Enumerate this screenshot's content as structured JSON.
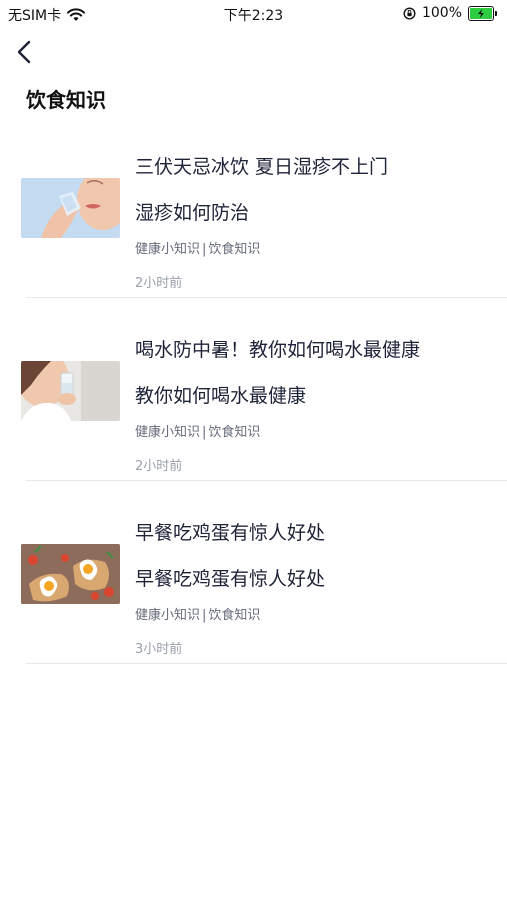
{
  "status_bar": {
    "carrier": "无SIM卡",
    "time": "下午2:23",
    "battery": "100%",
    "battery_color": "#2ecc40"
  },
  "header": {
    "back_icon": "chevron-left-icon",
    "title": "饮食知识"
  },
  "articles": [
    {
      "title": "三伏天忌冰饮 夏日湿疹不上门",
      "subtitle": "湿疹如何防治",
      "tag1": "健康小知识",
      "tag2": "饮食知识",
      "time": "2小时前"
    },
    {
      "title": " 喝水防中暑！教你如何喝水最健康",
      "subtitle": "教你如何喝水最健康",
      "tag1": "健康小知识",
      "tag2": "饮食知识",
      "time": "2小时前"
    },
    {
      "title": "早餐吃鸡蛋有惊人好处",
      "subtitle": "早餐吃鸡蛋有惊人好处",
      "tag1": "健康小知识",
      "tag2": "饮食知识",
      "time": "3小时前"
    }
  ]
}
